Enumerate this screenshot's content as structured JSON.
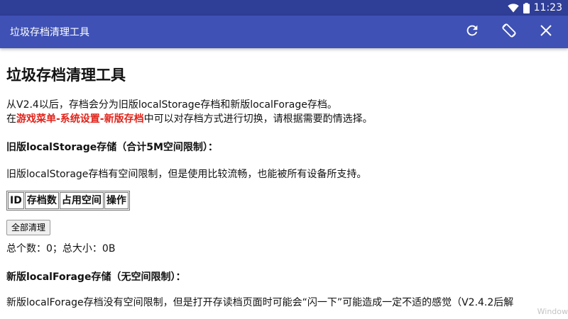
{
  "status_bar": {
    "time": "11:23"
  },
  "toolbar": {
    "title": "垃圾存档清理工具"
  },
  "content": {
    "heading": "垃圾存档清理工具",
    "intro_line1": "从V2.4以后，存档会分为旧版localStorage存档和新版localForage存档。",
    "intro_line2_prefix": "在",
    "intro_line2_highlight": "游戏菜单-系统设置-新版存档",
    "intro_line2_suffix": "中可以对存档方式进行切换，请根据需要酌情选择。",
    "legacy_heading": "旧版localStorage存储（合计5M空间限制）：",
    "legacy_desc": "旧版localStorage存档有空间限制，但是使用比较流畅，也能被所有设备所支持。",
    "table_headers": [
      "ID",
      "存档数",
      "占用空间",
      "操作"
    ],
    "clear_all_label": "全部清理",
    "totals": "总个数：0；总大小：0B",
    "forage_heading": "新版localForage存储（无空间限制）：",
    "forage_desc": "新版localForage存档没有空间限制，但是打开存读档页面时可能会“闪一下”可能造成一定不适的感觉（V2.4.2后解",
    "watermark": "Window"
  },
  "colors": {
    "status_bar": "#2f3e96",
    "toolbar": "#3f51b5",
    "highlight": "#e0241b"
  },
  "icons": [
    "wifi-icon",
    "battery-icon",
    "refresh-icon",
    "rotate-screen-icon",
    "close-icon"
  ]
}
